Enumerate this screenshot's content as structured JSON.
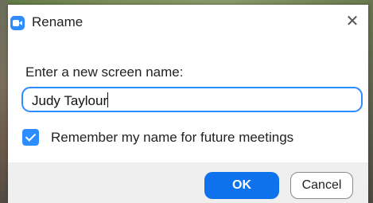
{
  "window": {
    "title": "Rename",
    "app_icon": "zoom-camera-icon",
    "close_icon": "close-icon",
    "close_glyph": "✕"
  },
  "form": {
    "prompt": "Enter a new screen name:",
    "name_value": "Judy Taylour",
    "remember_label": "Remember my name for future meetings",
    "remember_checked": true
  },
  "buttons": {
    "ok_label": "OK",
    "cancel_label": "Cancel"
  },
  "colors": {
    "accent": "#0e72ed",
    "input_border": "#2d8cff",
    "footer_bg": "#efefef"
  }
}
